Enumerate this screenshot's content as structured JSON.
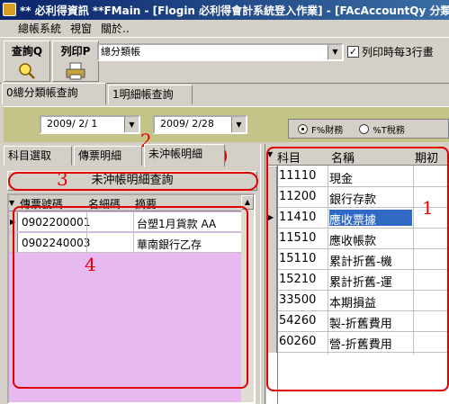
{
  "window": {
    "title": "** 必利得資訊 **FMain - [Flogin 必利得會計系統登入作業] - [FAcAccountQy 分類帳"
  },
  "menu": {
    "items": [
      "總帳系統",
      "視窗",
      "關於.."
    ]
  },
  "toolbar": {
    "query_label": "查詢Q",
    "print_label": "列印P",
    "report_value": "總分類帳",
    "print_option_label": "列印時每3行畫"
  },
  "main_tabs": [
    "0總分類帳查詢",
    "1明細帳查詢"
  ],
  "date_range": {
    "start": "2009/ 2/ 1",
    "end": "2009/ 2/28"
  },
  "report_type": {
    "options": [
      "F%財務",
      "%T稅務"
    ],
    "selected": "F%財務"
  },
  "left_tabs": [
    "科目選取",
    "傳票明細",
    "未沖帳明細"
  ],
  "subheader": "未沖帳明細查詢",
  "left_grid": {
    "columns": [
      "傳票號碼",
      "名細碼",
      "摘要"
    ],
    "rows": [
      {
        "voucher": "0902200001",
        "detail": "",
        "summary": "台塑1月貨款 AA"
      },
      {
        "voucher": "0902240003",
        "detail": "",
        "summary": "華南銀行乙存"
      }
    ]
  },
  "right_grid": {
    "columns": [
      "科目",
      "名稱",
      "期初借"
    ],
    "rows": [
      {
        "code": "11110",
        "name": "現金",
        "selected": false
      },
      {
        "code": "11200",
        "name": "銀行存款",
        "selected": false
      },
      {
        "code": "11410",
        "name": "應收票據",
        "selected": true
      },
      {
        "code": "11510",
        "name": "應收帳款",
        "selected": false
      },
      {
        "code": "15110",
        "name": "累計折舊-機",
        "selected": false
      },
      {
        "code": "15210",
        "name": "累計折舊-運",
        "selected": false
      },
      {
        "code": "33500",
        "name": "本期損益",
        "selected": false
      },
      {
        "code": "54260",
        "name": "製-折舊費用",
        "selected": false
      },
      {
        "code": "60260",
        "name": "營-折舊費用",
        "selected": false
      }
    ]
  },
  "annotations": [
    "1",
    "2",
    "3",
    "4"
  ],
  "colors": {
    "annotation": "#e00000",
    "grid_empty": "#e8b8f0",
    "filter_bar": "#c4c488",
    "selection": "#316ac5"
  }
}
